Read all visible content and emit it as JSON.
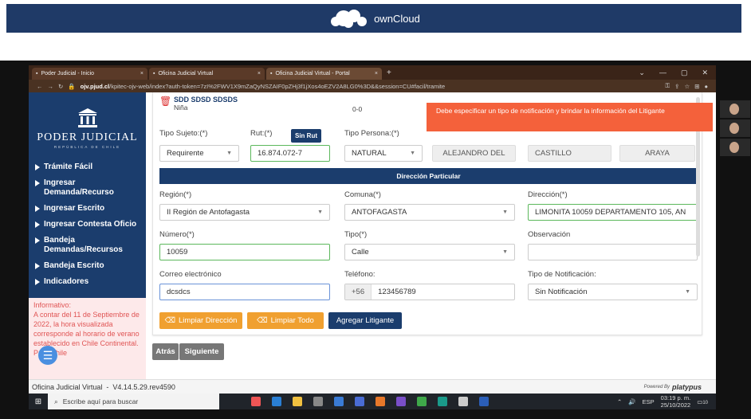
{
  "owncloud": {
    "brand": "ownCloud"
  },
  "browser": {
    "tabs": [
      {
        "label": "Poder Judicial - Inicio",
        "icon": "pj-favicon"
      },
      {
        "label": "Oficina Judicial Virtual",
        "icon": "ojv-favicon"
      },
      {
        "label": "Oficina Judicial Virtual - Portal",
        "icon": "ojv-favicon",
        "active": true
      }
    ],
    "url_domain": "ojv.pjud.cl",
    "url_rest": "/kpitec-ojv-web/index?auth-token=7zI%2FWV1X9mZaQyNSZAIF0pZHj3f1jXos4oEZV2A8LG0%3D&&session=CU#facil/tramite"
  },
  "sidebar": {
    "logo_name": "PODER JUDICIAL",
    "logo_sub": "REPÚBLICA DE CHILE",
    "items": [
      {
        "label": "Trámite Fácil"
      },
      {
        "label": "Ingresar Demanda/Recurso"
      },
      {
        "label": "Ingresar Escrito"
      },
      {
        "label": "Ingresar Contesta Oficio"
      },
      {
        "label": "Bandeja Demandas/Recursos"
      },
      {
        "label": "Bandeja Escrito"
      },
      {
        "label": "Indicadores"
      }
    ],
    "info": "Informativo:\nA contar del 11 de Septiembre de 2022, la hora visualizada corresponde al horario de verano establecido en Chile Continental. Para Chile"
  },
  "litigante": {
    "name": "SDD SDSD SDSDS",
    "sub": "Niña",
    "count": "0-0"
  },
  "toast": "Debe especificar un tipo de notificación y brindar la información del Litigante",
  "form": {
    "tipo_sujeto_label": "Tipo Sujeto:(*)",
    "tipo_sujeto_value": "Requirente",
    "rut_label": "Rut:(*)",
    "rut_value": "16.874.072-7",
    "sin_rut_label": "Sin Rut",
    "tipo_persona_label": "Tipo Persona:(*)",
    "tipo_persona_value": "NATURAL",
    "nombre": "ALEJANDRO DEL",
    "apellido_paterno": "CASTILLO",
    "apellido_materno": "ARAYA",
    "section_title": "Dirección Particular",
    "region_label": "Región(*)",
    "region_value": "II Región de Antofagasta",
    "comuna_label": "Comuna(*)",
    "comuna_value": "ANTOFAGASTA",
    "direccion_label": "Dirección(*)",
    "direccion_value": "LIMONITA 10059 DEPARTAMENTO 105, AN",
    "numero_label": "Número(*)",
    "numero_value": "10059",
    "tipo_label": "Tipo(*)",
    "tipo_value": "Calle",
    "observacion_label": "Observación",
    "observacion_value": "",
    "correo_label": "Correo electrónico",
    "correo_value": "dcsdcs",
    "telefono_label": "Teléfono:",
    "telefono_prefix": "+56",
    "telefono_value": "123456789",
    "tipo_notif_label": "Tipo de Notificación:",
    "tipo_notif_value": "Sin Notificación"
  },
  "buttons": {
    "limpiar_direccion": "Limpiar Dirección",
    "limpiar_todo": "Limpiar Todo",
    "agregar_litigante": "Agregar Litigante",
    "atras": "Atrás",
    "siguiente": "Siguiente"
  },
  "footer": {
    "version": "Oficina Judicial Virtual  -  V4.14.5.29.rev4590",
    "powered": "Powered By",
    "brand": "platypus"
  },
  "taskbar": {
    "search_placeholder": "Escribe aquí para buscar",
    "lang": "ESP",
    "time": "03:19 p. m.",
    "date": "25/10/2022",
    "notif_count": "10"
  },
  "colors": {
    "navy": "#1b3d6d",
    "toast": "#f4613b",
    "orange": "#f0a030",
    "valid": "#5cb85c"
  }
}
